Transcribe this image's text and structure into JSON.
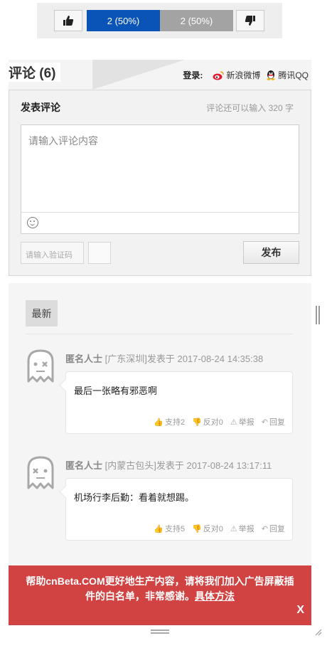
{
  "vote": {
    "up_icon": "thumbs-up-icon",
    "down_icon": "thumbs-down-icon",
    "yes_label": "2 (50%)",
    "no_label": "2 (50%)",
    "yes_percent": 50,
    "no_percent": 50,
    "yes_color": "#0a54b7",
    "no_color": "#a3a3a3"
  },
  "comments_header": {
    "title": "评论 (6)",
    "login_label": "登录:",
    "weibo_label": "新浪微博",
    "qq_label": "腾讯QQ"
  },
  "post_form": {
    "title": "发表评论",
    "remaining_text": "评论还可以输入 320 字",
    "placeholder": "请输入评论内容",
    "captcha_placeholder": "请输入验证码",
    "submit_label": "发布"
  },
  "sort": {
    "latest_label": "最新"
  },
  "comments": [
    {
      "user": "匿名人士",
      "meta": "[广东深圳]发表于 2017-08-24 14:35:38",
      "text": "最后一张略有邪恶啊",
      "support": "支持2",
      "oppose": "反对0",
      "report": "举报",
      "reply": "回复"
    },
    {
      "user": "匿名人士",
      "meta": "[内蒙古包头]发表于 2017-08-24 13:17:11",
      "text": "机场行李后勤：看着就想踢。",
      "support": "支持5",
      "oppose": "反对0",
      "report": "举报",
      "reply": "回复"
    }
  ],
  "ad_banner": {
    "text": "帮助cnBeta.COM更好地生产内容，请将我们加入广告屏蔽插件的白名单，非常感谢。",
    "link_label": "具体方法",
    "close_label": "X",
    "color": "#d14242"
  }
}
